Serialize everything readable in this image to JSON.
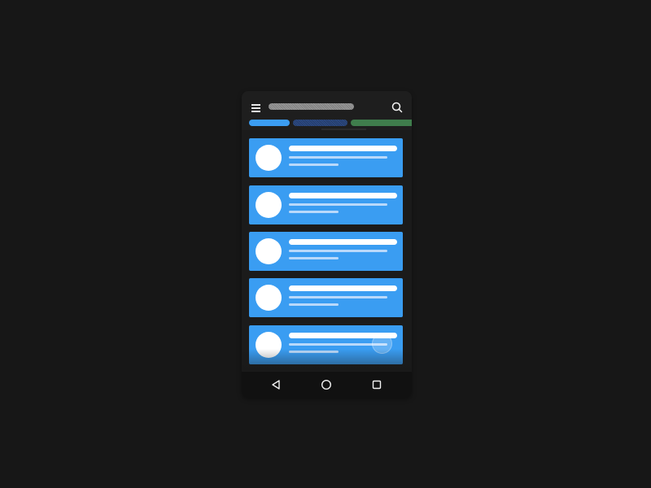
{
  "colors": {
    "background": "#171717",
    "card": "#3a9df2",
    "tab_active": "#3b9df2",
    "tab_secondary": "#2d4c86",
    "tab_tertiary": "#3f7d4c",
    "avatar": "#ffffff"
  },
  "appbar": {
    "menu_icon": "menu-icon",
    "search_icon": "search-icon"
  },
  "tabs": [
    {
      "name": "tab-1"
    },
    {
      "name": "tab-2"
    },
    {
      "name": "tab-3"
    }
  ],
  "list": {
    "items": [
      {
        "name": "list-item-1"
      },
      {
        "name": "list-item-2"
      },
      {
        "name": "list-item-3"
      },
      {
        "name": "list-item-4"
      },
      {
        "name": "list-item-5"
      }
    ]
  },
  "navigation": {
    "back_icon": "back-icon",
    "home_icon": "home-icon",
    "recent_icon": "recent-apps-icon"
  }
}
